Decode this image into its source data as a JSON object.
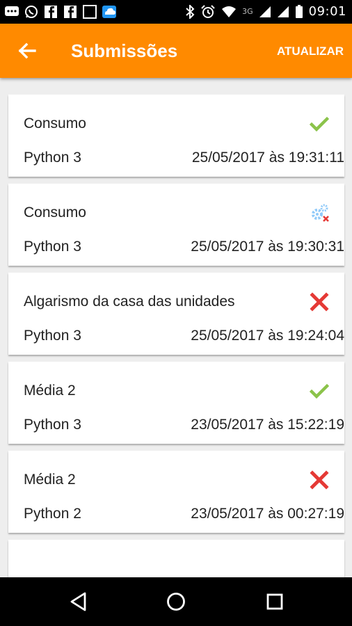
{
  "status_bar": {
    "time": "09:01",
    "network": "3G",
    "icons": [
      "chat-icon",
      "whatsapp-icon",
      "facebook-icon",
      "facebook-icon",
      "square-icon",
      "cloud-icon",
      "bluetooth-icon",
      "alarm-icon",
      "wifi-icon",
      "signal-icon",
      "signal-icon",
      "battery-icon"
    ]
  },
  "app_bar": {
    "back_icon": "arrow-back-icon",
    "title": "Submissões",
    "refresh_label": "ATUALIZAR",
    "color": "#ff8a00"
  },
  "submissions": [
    {
      "problem": "Consumo",
      "language": "Python 3",
      "date": "25/05/2017 às 19:31:11",
      "status": "accepted",
      "status_icon": "check-icon"
    },
    {
      "problem": "Consumo",
      "language": "Python 3",
      "date": "25/05/2017 às 19:30:31",
      "status": "compile-error",
      "status_icon": "gears-error-icon"
    },
    {
      "problem": "Algarismo da casa das unidades",
      "language": "Python 3",
      "date": "25/05/2017 às 19:24:04",
      "status": "wrong",
      "status_icon": "x-icon"
    },
    {
      "problem": "Média 2",
      "language": "Python 3",
      "date": "23/05/2017 às 15:22:19",
      "status": "accepted",
      "status_icon": "check-icon"
    },
    {
      "problem": "Média 2",
      "language": "Python 2",
      "date": "23/05/2017 às 00:27:19",
      "status": "wrong",
      "status_icon": "x-icon"
    }
  ],
  "colors": {
    "accepted": "#8bc34a",
    "wrong": "#e53935",
    "compile_error": "#90caf9"
  },
  "nav_bar": {
    "icons": [
      "back-triangle-icon",
      "home-circle-icon",
      "recents-square-icon"
    ]
  }
}
